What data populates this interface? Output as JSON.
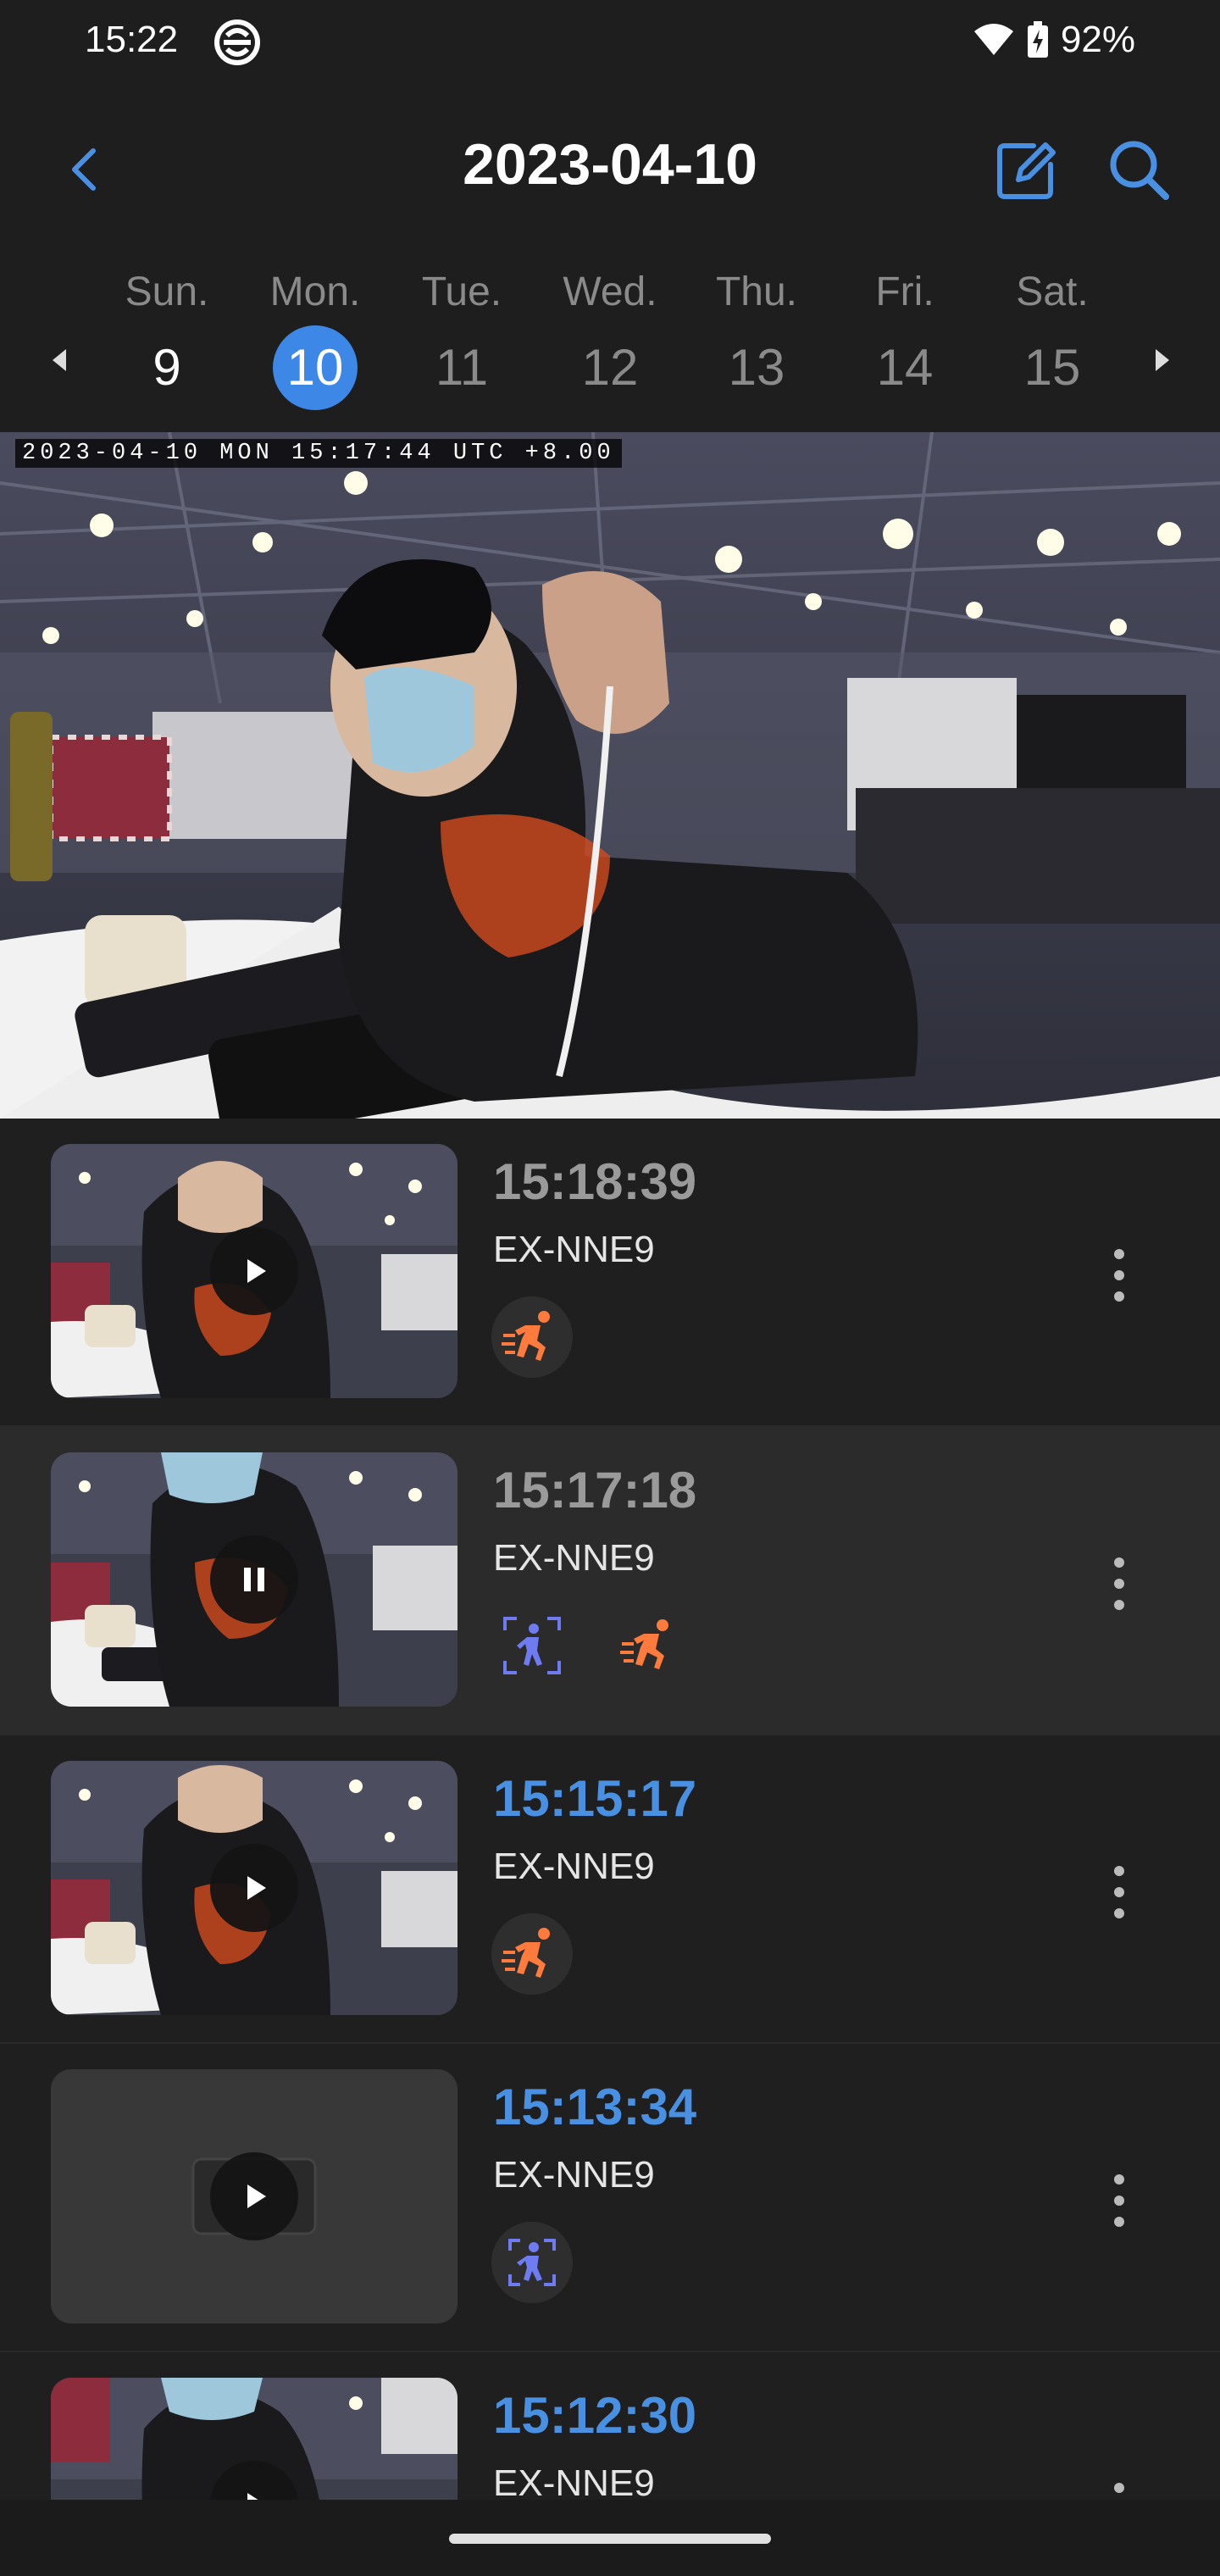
{
  "status_bar": {
    "time": "15:22",
    "battery": "92%"
  },
  "header": {
    "title": "2023-04-10"
  },
  "week": {
    "days": [
      {
        "name": "Sun.",
        "num": "9"
      },
      {
        "name": "Mon.",
        "num": "10"
      },
      {
        "name": "Tue.",
        "num": "11"
      },
      {
        "name": "Wed.",
        "num": "12"
      },
      {
        "name": "Thu.",
        "num": "13"
      },
      {
        "name": "Fri.",
        "num": "14"
      },
      {
        "name": "Sat.",
        "num": "15"
      }
    ]
  },
  "video": {
    "osd": "2023-04-10 MON 15:17:44 UTC +8.00"
  },
  "events": [
    {
      "time": "15:18:39",
      "device": "EX-NNE9",
      "tags": [
        "motion-icon"
      ],
      "state": "played"
    },
    {
      "time": "15:17:18",
      "device": "EX-NNE9",
      "tags": [
        "human-detect-icon",
        "motion-icon"
      ],
      "state": "playing"
    },
    {
      "time": "15:15:17",
      "device": "EX-NNE9",
      "tags": [
        "motion-icon"
      ],
      "state": "new"
    },
    {
      "time": "15:13:34",
      "device": "EX-NNE9",
      "tags": [
        "human-detect-icon"
      ],
      "state": "new"
    },
    {
      "time": "15:12:30",
      "device": "EX-NNE9",
      "tags": [],
      "state": "new"
    }
  ],
  "colors": {
    "accent": "#4a90e2",
    "motion": "#ff7a3d",
    "human": "#6f7bf0",
    "background": "#1f1f1f"
  }
}
